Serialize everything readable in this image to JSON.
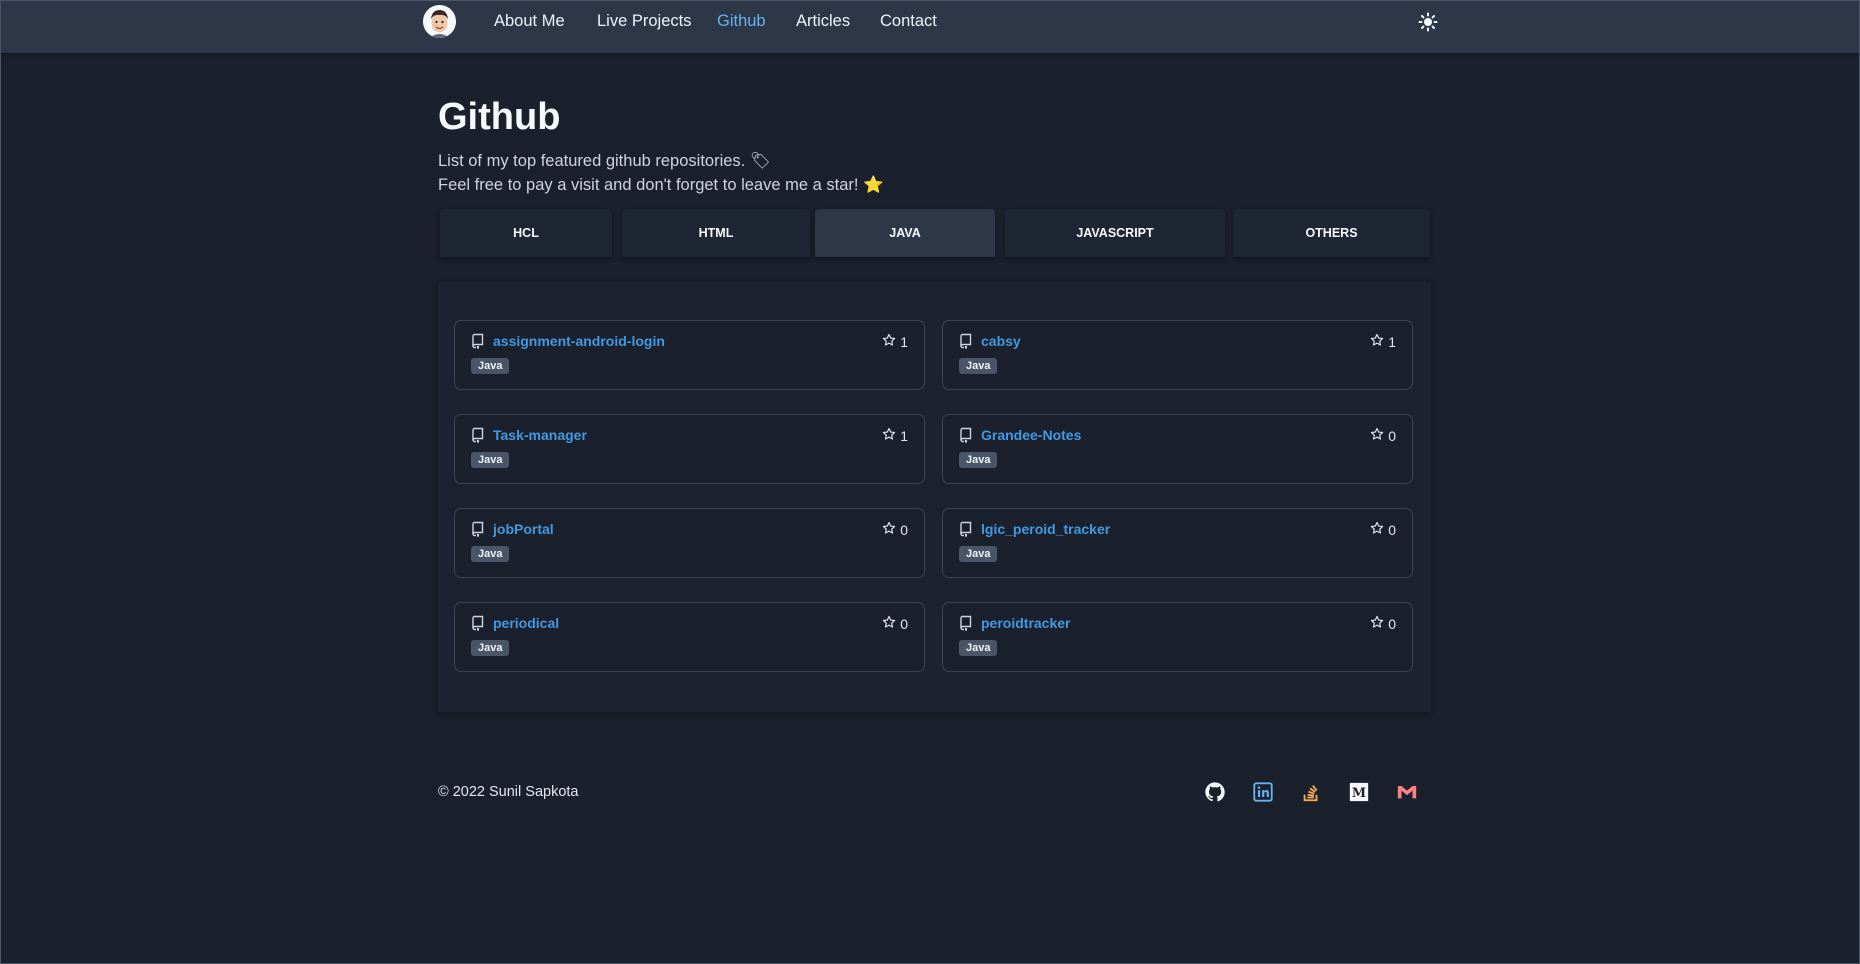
{
  "nav": {
    "links": [
      "About Me",
      "Live Projects",
      "Github",
      "Articles",
      "Contact"
    ],
    "active": "Github"
  },
  "header": {
    "title": "Github",
    "line1": "List of my top featured github repositories.",
    "line1_emoji": "🏷",
    "line2": "Feel free to pay a visit and don't forget to leave me a star!",
    "line2_emoji": "⭐"
  },
  "tabs": [
    "HCL",
    "HTML",
    "JAVA",
    "JAVASCRIPT",
    "OTHERS"
  ],
  "active_tab": "JAVA",
  "repos": [
    {
      "name": "assignment-android-login",
      "stars": "1",
      "language": "Java"
    },
    {
      "name": "cabsy",
      "stars": "1",
      "language": "Java"
    },
    {
      "name": "Task-manager",
      "stars": "1",
      "language": "Java"
    },
    {
      "name": "Grandee-Notes",
      "stars": "0",
      "language": "Java"
    },
    {
      "name": "jobPortal",
      "stars": "0",
      "language": "Java"
    },
    {
      "name": "lgic_peroid_tracker",
      "stars": "0",
      "language": "Java"
    },
    {
      "name": "periodical",
      "stars": "0",
      "language": "Java"
    },
    {
      "name": "peroidtracker",
      "stars": "0",
      "language": "Java"
    }
  ],
  "footer": {
    "copyright": "© 2022 Sunil Sapkota",
    "social_icons": [
      "github-icon",
      "linkedin-icon",
      "stackoverflow-icon",
      "medium-icon",
      "gmail-icon"
    ]
  },
  "colors": {
    "background": "#1a202c",
    "nav": "#2d3748",
    "accent": "#63b3ed",
    "link": "#4299e1"
  }
}
